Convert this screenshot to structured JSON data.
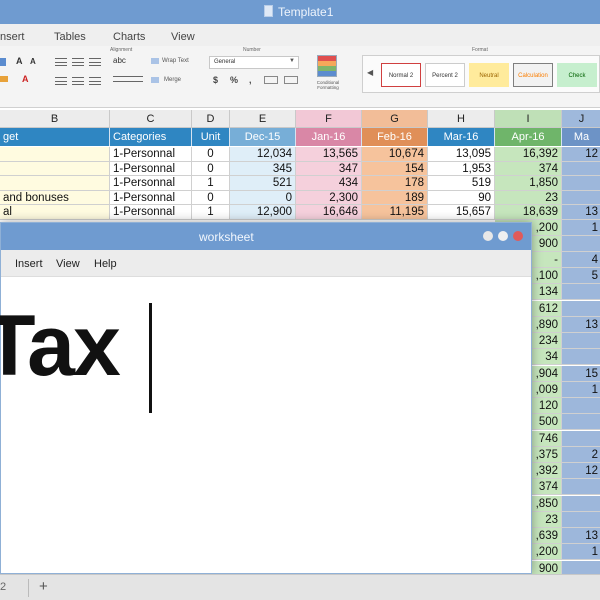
{
  "back_window": {
    "title": "Template1",
    "menu_tabs": [
      "nsert",
      "Tables",
      "Charts",
      "View"
    ],
    "ribbon": {
      "alignment_label": "Alignment",
      "number_label": "Number",
      "format_label": "Format",
      "wrap_text_label": "Wrap Text",
      "merge_label": "Merge",
      "number_format_value": "General",
      "abc_label": "abc",
      "conditional_formatting_label": "Conditional Formatting",
      "font_a_large": "A",
      "font_a_small": "A",
      "format_symbols": [
        "$",
        "%",
        ","
      ],
      "styles": [
        {
          "label": "Normal 2",
          "bg": "#ffffff",
          "fg": "#333333",
          "border": "#d04040"
        },
        {
          "label": "Percent 2",
          "bg": "#ffffff",
          "fg": "#333333",
          "border": "#cccccc"
        },
        {
          "label": "Neutral",
          "bg": "#ffeb9c",
          "fg": "#9c6500",
          "border": "#ffeb9c"
        },
        {
          "label": "Calculation",
          "bg": "#f2f2f2",
          "fg": "#fa7d00",
          "border": "#7f7f7f"
        },
        {
          "label": "Check",
          "bg": "#c6efce",
          "fg": "#006100",
          "border": "#c6efce"
        }
      ]
    }
  },
  "spreadsheet": {
    "column_letters": [
      "B",
      "C",
      "D",
      "E",
      "F",
      "G",
      "H",
      "I",
      "J"
    ],
    "headers": [
      "get",
      "Categories",
      "Unit",
      "Dec-15",
      "Jan-16",
      "Feb-16",
      "Mar-16",
      "Apr-16",
      "Ma"
    ],
    "rows": [
      [
        "",
        "1-Personnal",
        "0",
        "12,034",
        "13,565",
        "10,674",
        "13,095",
        "16,392",
        "12"
      ],
      [
        "",
        "1-Personnal",
        "0",
        "345",
        "347",
        "154",
        "1,953",
        "374",
        ""
      ],
      [
        "",
        "1-Personnal",
        "1",
        "521",
        "434",
        "178",
        "519",
        "1,850",
        ""
      ],
      [
        "and bonuses",
        "1-Personnal",
        "0",
        "0",
        "2,300",
        "189",
        "90",
        "23",
        ""
      ],
      [
        "al",
        "1-Personnal",
        "1",
        "12,900",
        "16,646",
        "11,195",
        "15,657",
        "18,639",
        "13"
      ]
    ],
    "right_column_i": [
      ",200",
      "900",
      "-",
      ",100",
      "134",
      "612",
      ",890",
      "234",
      "34",
      ",904",
      ",009",
      "120",
      "500",
      "746",
      ",375",
      ",392",
      "374",
      ",850",
      "23",
      ",639",
      ",200",
      "900"
    ],
    "right_column_j": [
      "1",
      "",
      "4",
      "5",
      "",
      "",
      "13",
      "",
      "",
      "15",
      "1",
      "",
      "",
      "",
      "2",
      "12",
      "",
      "",
      "",
      "13",
      "1",
      ""
    ]
  },
  "front_window": {
    "title": "worksheet",
    "menu": [
      "Insert",
      "View",
      "Help"
    ],
    "document_text": "Tax"
  },
  "sheet_bar": {
    "tab_number": "2",
    "add_label": "+"
  },
  "colors": {
    "titlebar": "#6f9bd0",
    "header_blue": "#2f86c2",
    "col_E": "#dfeef8",
    "col_F": "#f5d0dc",
    "col_G": "#f6c39c",
    "col_H": "#ffffff",
    "col_I": "#c6e6bd",
    "col_J": "#9db7db",
    "col_B": "#fffbe0",
    "btn_min": "#e8e8e8",
    "btn_max": "#f0f0f0",
    "btn_close": "#e05a5a"
  }
}
